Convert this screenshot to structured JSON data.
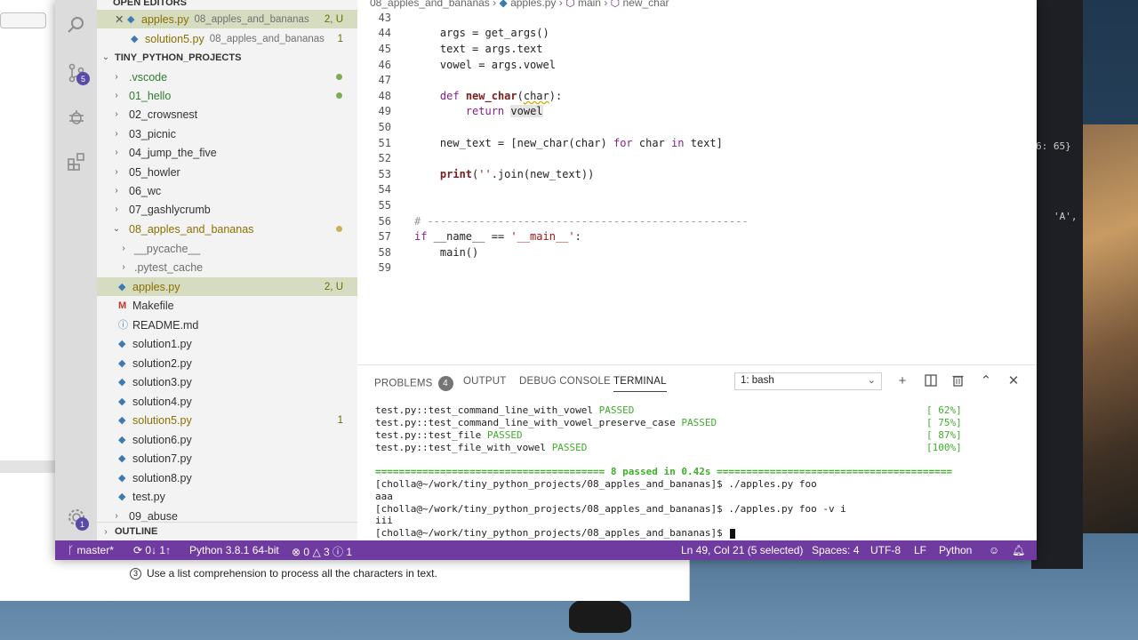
{
  "background": {
    "right_window_lines": [
      "6: 65}",
      "'A',"
    ],
    "doc_lines": [
      {
        "num": "③",
        "text": "Use a list comprehension to process all the characters in text."
      }
    ]
  },
  "activity_bar": {
    "scm_badge": "5",
    "settings_badge": "1"
  },
  "sidebar": {
    "open_editors_header": "OPEN EDITORS",
    "open_editors": [
      {
        "name": "apples.py",
        "desc": "08_apples_and_bananas",
        "badge": "2, U"
      },
      {
        "name": "solution5.py",
        "desc": "08_apples_and_bananas",
        "badge": "1"
      }
    ],
    "project_header": "TINY_PYTHON_PROJECTS",
    "folders": [
      ".vscode",
      "01_hello",
      "02_crowsnest",
      "03_picnic",
      "04_jump_the_five",
      "05_howler",
      "06_wc",
      "07_gashlycrumb",
      "08_apples_and_bananas"
    ],
    "subfolders": [
      "__pycache__",
      ".pytest_cache"
    ],
    "files": [
      {
        "name": "apples.py",
        "badge": "2, U"
      },
      {
        "name": "Makefile",
        "badge": ""
      },
      {
        "name": "README.md",
        "badge": ""
      },
      {
        "name": "solution1.py",
        "badge": ""
      },
      {
        "name": "solution2.py",
        "badge": ""
      },
      {
        "name": "solution3.py",
        "badge": ""
      },
      {
        "name": "solution4.py",
        "badge": ""
      },
      {
        "name": "solution5.py",
        "badge": "1"
      },
      {
        "name": "solution6.py",
        "badge": ""
      },
      {
        "name": "solution7.py",
        "badge": ""
      },
      {
        "name": "solution8.py",
        "badge": ""
      },
      {
        "name": "test.py",
        "badge": ""
      }
    ],
    "last_folder": "09_abuse",
    "outline_header": "OUTLINE"
  },
  "editor": {
    "breadcrumb": [
      "08_apples_and_bananas",
      "apples.py",
      "main",
      "new_char"
    ],
    "line_numbers": [
      "43",
      "44",
      "45",
      "46",
      "47",
      "48",
      "49",
      "50",
      "51",
      "52",
      "53",
      "54",
      "55",
      "56",
      "57",
      "58",
      "59"
    ]
  },
  "panel": {
    "tabs": {
      "problems": "PROBLEMS",
      "problems_count": "4",
      "output": "OUTPUT",
      "debug": "DEBUG CONSOLE",
      "terminal": "TERMINAL"
    },
    "terminal_select": "1: bash",
    "test_lines": [
      {
        "name": "test.py::test_command_line_with_vowel",
        "status": "PASSED",
        "pct": "[ 62%]"
      },
      {
        "name": "test.py::test_command_line_with_vowel_preserve_case",
        "status": "PASSED",
        "pct": "[ 75%]"
      },
      {
        "name": "test.py::test_file",
        "status": "PASSED",
        "pct": "[ 87%]"
      },
      {
        "name": "test.py::test_file_with_vowel",
        "status": "PASSED",
        "pct": "[100%]"
      }
    ],
    "summary": "======================================= 8 passed in 0.42s ========================================",
    "prompt": "[cholla@~/work/tiny_python_projects/08_apples_and_bananas]$",
    "cmd1": " ./apples.py foo",
    "out1": "aaa",
    "cmd2": " ./apples.py foo -v i",
    "out2": "iii"
  },
  "statusbar": {
    "branch": "master*",
    "sync": "0↓ 1↑",
    "python": "Python 3.8.1 64-bit",
    "errors": "0",
    "warnings": "3",
    "info": "1",
    "position": "Ln 49, Col 21 (5 selected)",
    "spaces": "Spaces: 4",
    "encoding": "UTF-8",
    "eol": "LF",
    "language": "Python"
  }
}
